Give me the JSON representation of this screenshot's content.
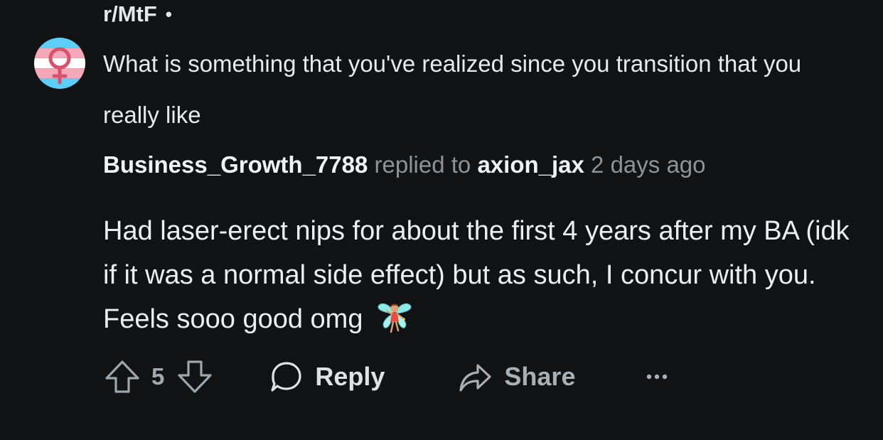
{
  "header": {
    "subreddit": "r/MtF",
    "separator": "•"
  },
  "post": {
    "title": "What is something that you've realized since you transition that you really like"
  },
  "comment": {
    "author": "Business_Growth_7788",
    "replied_text": "replied to",
    "replied_user": "axion_jax",
    "timestamp": "2 days ago",
    "body": "Had laser-erect nips for about the first 4 years after my BA (idk if it was a normal side effect) but as such, I concur with you. Feels sooo good omg",
    "emoji": "fairy-emoji"
  },
  "actions": {
    "vote_count": "5",
    "reply_label": "Reply",
    "share_label": "Share",
    "more_label": "•••"
  },
  "colors": {
    "background": "#111214",
    "muted_text": "#8d9397",
    "pink": "#f5a9b8",
    "blue": "#5bcefa"
  }
}
